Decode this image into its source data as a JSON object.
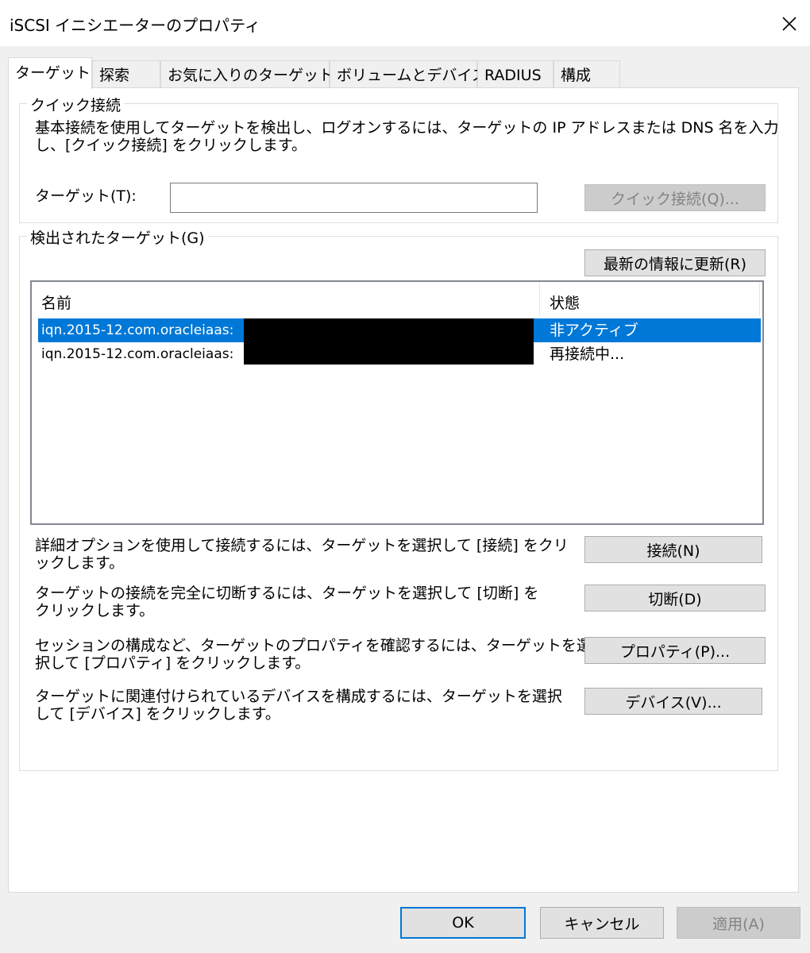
{
  "window": {
    "title": "iSCSI イニシエーターのプロパティ",
    "close_icon": "close-icon"
  },
  "tabs": [
    {
      "label": "ターゲット",
      "active": true
    },
    {
      "label": "探索"
    },
    {
      "label": "お気に入りのターゲット"
    },
    {
      "label": "ボリュームとデバイス"
    },
    {
      "label": "RADIUS"
    },
    {
      "label": "構成"
    }
  ],
  "quick_connect": {
    "legend": "クイック接続",
    "description_line1": "基本接続を使用してターゲットを検出し、ログオンするには、ターゲットの IP アドレスまたは DNS 名を入力",
    "description_line2": "し、[クイック接続] をクリックします。",
    "target_label": "ターゲット(T):",
    "target_value": "",
    "button_label": "クイック接続(Q)..."
  },
  "discovered": {
    "legend": "検出されたターゲット(G)",
    "refresh_button": "最新の情報に更新(R)",
    "columns": {
      "name": "名前",
      "status": "状態"
    },
    "rows": [
      {
        "name": "iqn.2015-12.com.oracleiaas:",
        "status": "非アクティブ",
        "selected": true
      },
      {
        "name": "iqn.2015-12.com.oracleiaas:",
        "status": "再接続中..."
      }
    ]
  },
  "actions": [
    {
      "line1": "詳細オプションを使用して接続するには、ターゲットを選択して [接続] をクリ",
      "line2": "ックします。",
      "button": "接続(N)"
    },
    {
      "line1": "ターゲットの接続を完全に切断するには、ターゲットを選択して [切断] を",
      "line2": "クリックします。",
      "button": "切断(D)"
    },
    {
      "line1": "セッションの構成など、ターゲットのプロパティを確認するには、ターゲットを選",
      "line2": "択して [プロパティ] をクリックします。",
      "button": "プロパティ(P)..."
    },
    {
      "line1": "ターゲットに関連付けられているデバイスを構成するには、ターゲットを選択",
      "line2": "して [デバイス] をクリックします。",
      "button": "デバイス(V)..."
    }
  ],
  "footer": {
    "ok": "OK",
    "cancel": "キャンセル",
    "apply": "適用(A)"
  },
  "colors": {
    "selection": "#0078d7",
    "dialog_bg": "#f0f0f0",
    "button_bg": "#e1e1e1"
  }
}
